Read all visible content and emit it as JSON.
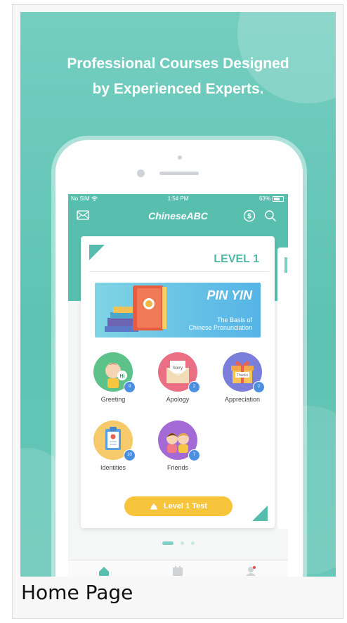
{
  "headline": {
    "line1": "Professional Courses Designed",
    "line2": "by Experienced Experts."
  },
  "status": {
    "carrier": "No SIM",
    "time": "1:54 PM",
    "battery": "63%"
  },
  "app": {
    "title": "ChineseABC"
  },
  "level": {
    "title": "LEVEL 1"
  },
  "banner": {
    "title": "PIN YIN",
    "subtitle_line1": "The Basis of",
    "subtitle_line2": "Chinese Pronunciation"
  },
  "courses": [
    {
      "label": "Greeting",
      "badge": "9"
    },
    {
      "label": "Apology",
      "badge": "2"
    },
    {
      "label": "Appreciation",
      "badge": "2"
    },
    {
      "label": "Identities",
      "badge": "10"
    },
    {
      "label": "Friends",
      "badge": "7"
    }
  ],
  "test_button": {
    "label": "Level 1 Test"
  },
  "caption": "Home Page",
  "colors": {
    "accent": "#5ec2b2",
    "level": "#4fb8a7",
    "button": "#f7c53c"
  },
  "icons": [
    "mail-icon",
    "coin-icon",
    "search-icon",
    "home-icon",
    "calendar-icon",
    "profile-icon",
    "wifi-icon",
    "battery-icon"
  ]
}
